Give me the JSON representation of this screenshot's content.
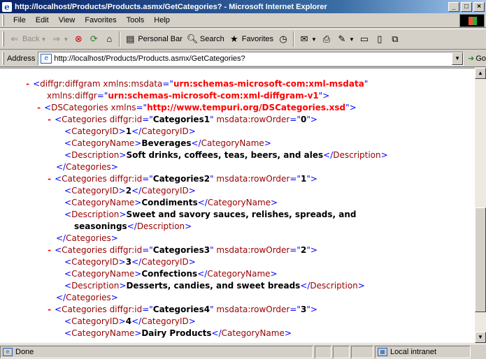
{
  "window": {
    "title": "http://localhost/Products/Products.asmx/GetCategories? - Microsoft Internet Explorer"
  },
  "menu": [
    "File",
    "Edit",
    "View",
    "Favorites",
    "Tools",
    "Help"
  ],
  "toolbar": {
    "back": "Back",
    "personal_bar": "Personal Bar",
    "search": "Search",
    "favorites": "Favorites"
  },
  "address": {
    "label": "Address",
    "url": "http://localhost/Products/Products.asmx/GetCategories?",
    "go": "Go"
  },
  "xml": {
    "diffgram_tag": "diffgr:diffgram",
    "xmlns_msdata_attr": "xmlns:msdata",
    "msdata_ns": "urn:schemas-microsoft-com:xml-msdata",
    "xmlns_diffgr_attr": "xmlns:diffgr",
    "diffgr_ns": "urn:schemas-microsoft-com:xml-diffgram-v1",
    "dscat_tag": "DSCategories",
    "xmlns_attr": "xmlns",
    "dscat_ns": "http://www.tempuri.org/DSCategories.xsd",
    "categories_tag": "Categories",
    "diffgr_id_attr": "diffgr:id",
    "roworder_attr": "msdata:rowOrder",
    "categoryid_tag": "CategoryID",
    "categoryname_tag": "CategoryName",
    "description_tag": "Description",
    "records": [
      {
        "id_attr": "Categories1",
        "row_order": "0",
        "category_id": "1",
        "name": "Beverages",
        "description": "Soft drinks, coffees, teas, beers, and ales"
      },
      {
        "id_attr": "Categories2",
        "row_order": "1",
        "category_id": "2",
        "name": "Condiments",
        "description_line1": "Sweet and savory sauces, relishes, spreads, and",
        "description_line2": "seasonings"
      },
      {
        "id_attr": "Categories3",
        "row_order": "2",
        "category_id": "3",
        "name": "Confections",
        "description": "Desserts, candies, and sweet breads"
      },
      {
        "id_attr": "Categories4",
        "row_order": "3",
        "category_id": "4",
        "name": "Dairy Products"
      }
    ]
  },
  "status": {
    "text": "Done",
    "zone": "Local intranet"
  }
}
